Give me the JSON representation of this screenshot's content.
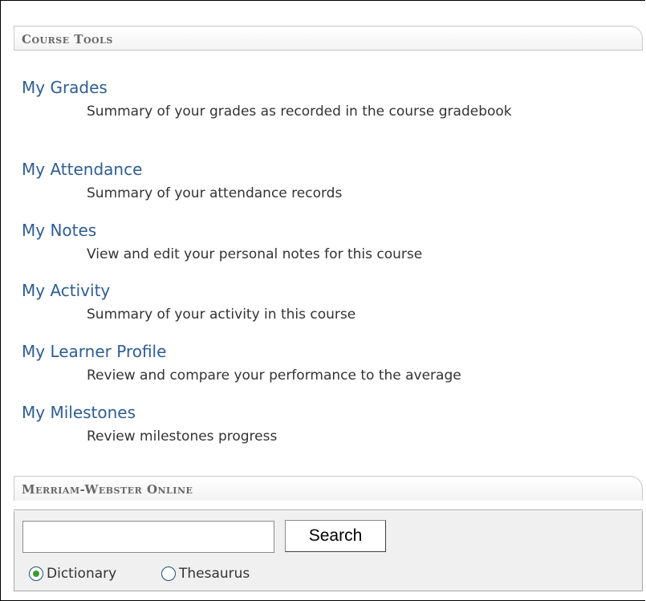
{
  "course_tools": {
    "header": "Course Tools",
    "items": [
      {
        "label": "My Grades",
        "description": "Summary of your grades as recorded in the course gradebook"
      },
      {
        "label": "My Attendance",
        "description": "Summary of your attendance records"
      },
      {
        "label": "My Notes",
        "description": "View and edit your personal notes for this course"
      },
      {
        "label": "My Activity",
        "description": "Summary of your activity in this course"
      },
      {
        "label": "My Learner Profile",
        "description": "Review and compare your performance to the average"
      },
      {
        "label": "My Milestones",
        "description": "Review milestones progress"
      }
    ]
  },
  "merriam_webster": {
    "header": "Merriam-Webster Online",
    "search_value": "",
    "search_button": "Search",
    "options": [
      {
        "label": "Dictionary",
        "selected": true
      },
      {
        "label": "Thesaurus",
        "selected": false
      }
    ]
  },
  "colors": {
    "link": "#2f5d91",
    "header_text": "#666666",
    "panel_background": "#f0f0f0"
  }
}
